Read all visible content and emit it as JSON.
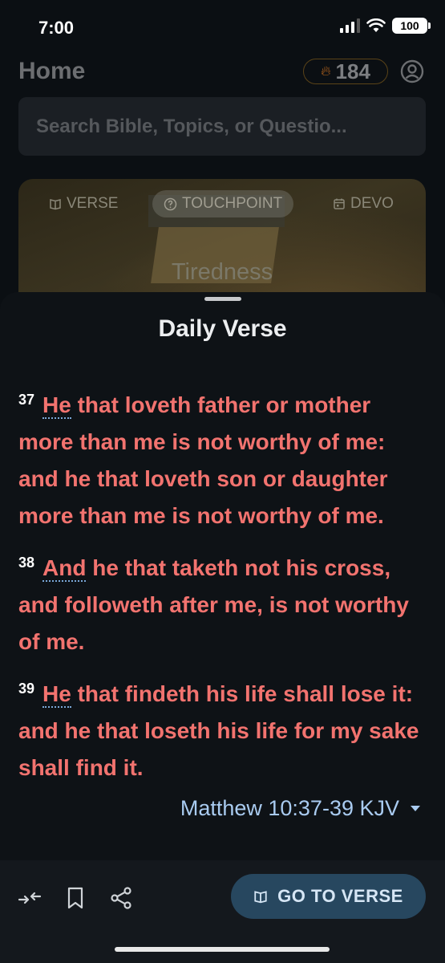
{
  "status_bar": {
    "time": "7:00",
    "battery": "100"
  },
  "home": {
    "title": "Home",
    "streak_count": "184",
    "search_placeholder": "Search Bible, Topics, or Questio...",
    "hero_tabs": [
      {
        "label": "VERSE",
        "icon": "book-icon"
      },
      {
        "label": "TOUCHPOINT",
        "icon": "question-circle-icon",
        "active": true
      },
      {
        "label": "DEVO",
        "icon": "calendar-icon"
      }
    ],
    "hero_topic": "Tiredness"
  },
  "sheet": {
    "title": "Daily Verse",
    "verses": [
      {
        "number": "37",
        "first_word": "He",
        "text": " that loveth father or mother more than me is not worthy of me: and he that loveth son or daughter more than me is not worthy of me."
      },
      {
        "number": "38",
        "first_word": "And",
        "text": " he that taketh not his cross, and followeth after me, is not worthy of me."
      },
      {
        "number": "39",
        "first_word": "He",
        "text": " that findeth his life shall lose it: and he that loseth his life for my sake shall find it."
      }
    ],
    "reference": "Matthew 10:37-39 KJV"
  },
  "bottom_bar": {
    "icons": [
      "collapse-icon",
      "bookmark-icon",
      "share-icon"
    ],
    "go_button_label": "GO TO VERSE"
  },
  "colors": {
    "verse_text": "#f2736f",
    "reference": "#a9cbf0",
    "button_bg": "#27475f"
  }
}
